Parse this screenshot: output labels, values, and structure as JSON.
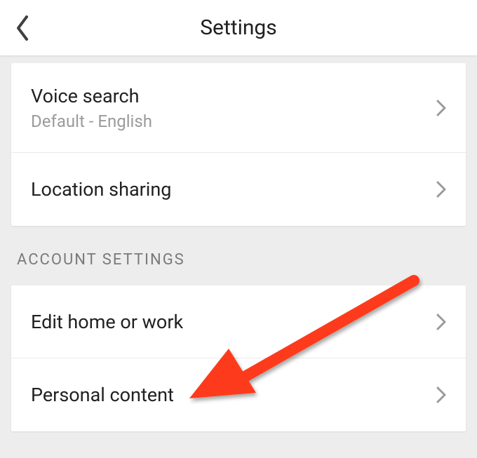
{
  "header": {
    "title": "Settings"
  },
  "group1": {
    "items": [
      {
        "title": "Voice search",
        "subtitle": "Default - English"
      },
      {
        "title": "Location sharing"
      }
    ]
  },
  "section_header": "ACCOUNT SETTINGS",
  "group2": {
    "items": [
      {
        "title": "Edit home or work"
      },
      {
        "title": "Personal content"
      }
    ]
  }
}
